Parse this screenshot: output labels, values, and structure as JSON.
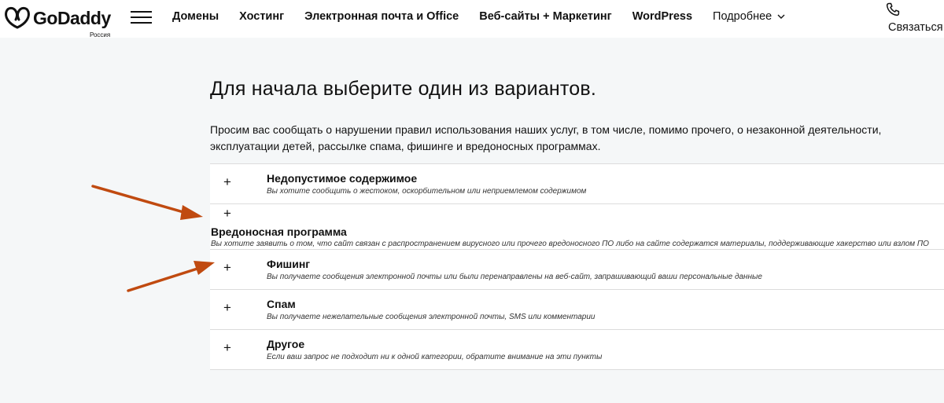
{
  "header": {
    "logo_text": "GoDaddy",
    "logo_region": "Россия",
    "nav": [
      {
        "label": "Домены"
      },
      {
        "label": "Хостинг"
      },
      {
        "label": "Электронная почта и Office"
      },
      {
        "label": "Веб-сайты + Маркетинг"
      },
      {
        "label": "WordPress"
      }
    ],
    "more_label": "Подробнее",
    "contact_label": "Связаться с",
    "icons": {
      "menu": "hamburger-icon",
      "more": "chevron-down-icon",
      "contact": "phone-icon"
    }
  },
  "main": {
    "title": "Для начала выберите один из вариантов.",
    "intro": "Просим вас сообщать о нарушении правил использования наших услуг, в том числе, помимо прочего, о незаконной деятельности, эксплуатации детей, рассылке спама, фишинге и вредоносных программах.",
    "expand_symbol": "+",
    "options": [
      {
        "title": "Недопустимое содержимое",
        "description": "Вы хотите сообщить о жестоком, оскорбительном или неприемлемом содержимом"
      },
      {
        "title": "Вредоносная программа",
        "description": "Вы хотите заявить о том, что сайт связан с распространением вирусного или прочего вредоносного ПО либо на сайте содержатся материалы, поддерживающие хакерство или взлом ПО"
      },
      {
        "title": "Фишинг",
        "description": "Вы получаете сообщения электронной почты или были перенаправлены на веб-сайт, запрашивающий ваши персональные данные"
      },
      {
        "title": "Спам",
        "description": "Вы получаете нежелательные сообщения электронной почты, SMS или комментарии"
      },
      {
        "title": "Другое",
        "description": "Если ваш запрос не подходит ни к одной категории, обратите внимание на эти пункты"
      }
    ]
  },
  "colors": {
    "background": "#f5f7f8",
    "panel": "#ffffff",
    "border": "#dcdcdc",
    "text": "#111111",
    "annotation_arrow": "#c04a10"
  }
}
